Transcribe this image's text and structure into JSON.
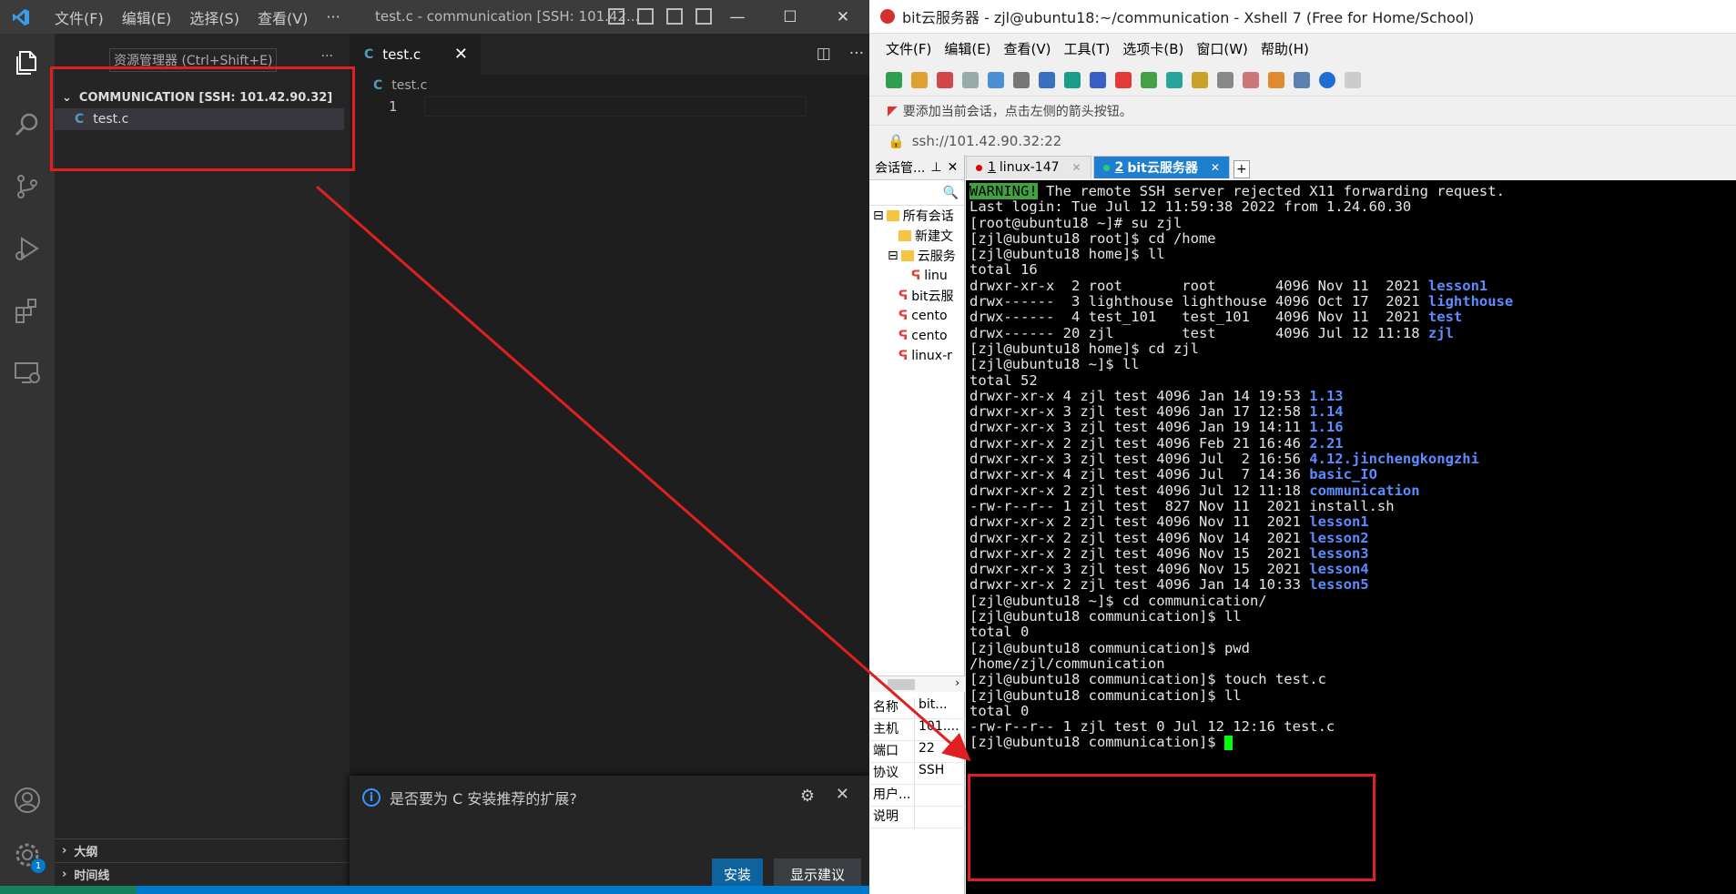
{
  "vscode": {
    "menu": [
      "文件(F)",
      "编辑(E)",
      "选择(S)",
      "查看(V)",
      "···"
    ],
    "title": "test.c - communication [SSH: 101.42...",
    "sidebar": {
      "header_tooltip": "资源管理器 (Ctrl+Shift+E)",
      "more": "···",
      "section_title": "COMMUNICATION [SSH: 101.42.90.32]",
      "file": "test.c",
      "outline": "大纲",
      "timeline": "时间线"
    },
    "editor": {
      "tab_label": "test.c",
      "breadcrumb": "test.c",
      "line_number": "1"
    },
    "notification": {
      "message": "是否要为 C 安装推荐的扩展?",
      "install_label": "安装",
      "show_label": "显示建议"
    },
    "accounts_badge": "1",
    "accent": "#007acc"
  },
  "xshell": {
    "title": "bit云服务器 - zjl@ubuntu18:~/communication - Xshell 7 (Free for Home/School)",
    "menu": [
      "文件(F)",
      "编辑(E)",
      "查看(V)",
      "工具(T)",
      "选项卡(B)",
      "窗口(W)",
      "帮助(H)"
    ],
    "hint": "要添加当前会话，点击左侧的箭头按钮。",
    "address": "ssh://101.42.90.32:22",
    "session_panel_title": "会话管...",
    "tree": [
      "所有会话",
      "新建文",
      "云服务",
      "linu",
      "bit云服",
      "cento",
      "cento",
      "linux-r"
    ],
    "props": [
      {
        "k": "名称",
        "v": "bit..."
      },
      {
        "k": "主机",
        "v": "101...."
      },
      {
        "k": "端口",
        "v": "22"
      },
      {
        "k": "协议",
        "v": "SSH"
      },
      {
        "k": "用户...",
        "v": ""
      },
      {
        "k": "说明",
        "v": ""
      }
    ],
    "tabs": [
      {
        "num": "1",
        "label": "linux-147"
      },
      {
        "num": "2",
        "label": "bit云服务器"
      }
    ],
    "terminal": {
      "warn_label": "WARNING!",
      "warn_rest": " The remote SSH server rejected X11 forwarding request.",
      "lines_a": [
        "Last login: Tue Jul 12 11:59:38 2022 from 1.24.60.30",
        "[root@ubuntu18 ~]# su zjl",
        "[zjl@ubuntu18 root]$ cd /home",
        "[zjl@ubuntu18 home]$ ll",
        "total 16"
      ],
      "home_rows": [
        {
          "p": "drwxr-xr-x  2 root       root       4096 Nov 11  2021 ",
          "d": "lesson1"
        },
        {
          "p": "drwx------  3 lighthouse lighthouse 4096 Oct 17  2021 ",
          "d": "lighthouse"
        },
        {
          "p": "drwx------  4 test_101   test_101   4096 Nov 11  2021 ",
          "d": "test"
        },
        {
          "p": "drwx------ 20 zjl        test       4096 Jul 12 11:18 ",
          "d": "zjl"
        }
      ],
      "lines_b": [
        "[zjl@ubuntu18 home]$ cd zjl",
        "[zjl@ubuntu18 ~]$ ll",
        "total 52"
      ],
      "zjl_rows": [
        {
          "p": "drwxr-xr-x 4 zjl test 4096 Jan 14 19:53 ",
          "d": "1.13"
        },
        {
          "p": "drwxr-xr-x 3 zjl test 4096 Jan 17 12:58 ",
          "d": "1.14"
        },
        {
          "p": "drwxr-xr-x 3 zjl test 4096 Jan 19 14:11 ",
          "d": "1.16"
        },
        {
          "p": "drwxr-xr-x 2 zjl test 4096 Feb 21 16:46 ",
          "d": "2.21"
        },
        {
          "p": "drwxr-xr-x 3 zjl test 4096 Jul  2 16:56 ",
          "d": "4.12.jinchengkongzhi"
        },
        {
          "p": "drwxr-xr-x 4 zjl test 4096 Jul  7 14:36 ",
          "d": "basic_IO"
        },
        {
          "p": "drwxr-xr-x 2 zjl test 4096 Jul 12 11:18 ",
          "d": "communication"
        },
        {
          "p": "-rw-r--r-- 1 zjl test  827 Nov 11  2021 install.sh",
          "d": ""
        },
        {
          "p": "drwxr-xr-x 2 zjl test 4096 Nov 11  2021 ",
          "d": "lesson1"
        },
        {
          "p": "drwxr-xr-x 2 zjl test 4096 Nov 14  2021 ",
          "d": "lesson2"
        },
        {
          "p": "drwxr-xr-x 2 zjl test 4096 Nov 15  2021 ",
          "d": "lesson3"
        },
        {
          "p": "drwxr-xr-x 3 zjl test 4096 Nov 15  2021 ",
          "d": "lesson4"
        },
        {
          "p": "drwxr-xr-x 2 zjl test 4096 Jan 14 10:33 ",
          "d": "lesson5"
        }
      ],
      "lines_c": [
        "[zjl@ubuntu18 ~]$ cd communication/",
        "[zjl@ubuntu18 communication]$ ll",
        "total 0",
        "[zjl@ubuntu18 communication]$ pwd",
        "/home/zjl/communication",
        "[zjl@ubuntu18 communication]$ touch test.c",
        "[zjl@ubuntu18 communication]$ ll",
        "total 0",
        "-rw-r--r-- 1 zjl test 0 Jul 12 12:16 test.c"
      ],
      "prompt": "[zjl@ubuntu18 communication]$ "
    },
    "dir_color": "#5c8cff",
    "active_tab_color": "#1e7fce"
  }
}
